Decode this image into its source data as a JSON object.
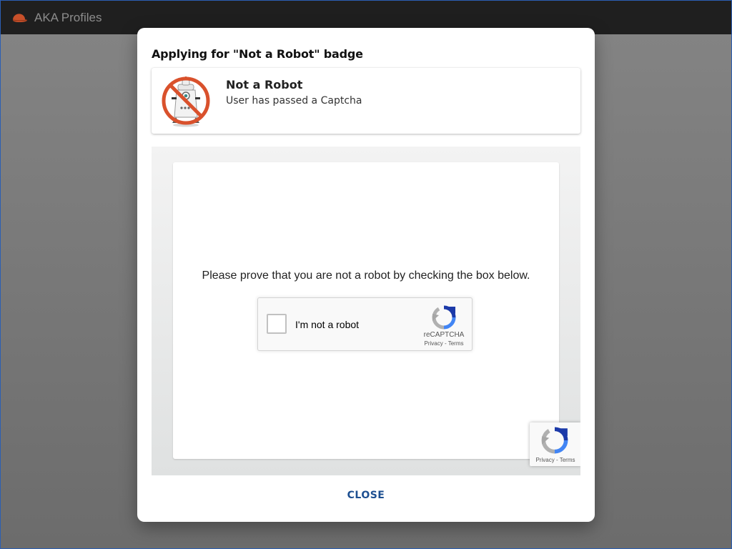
{
  "app": {
    "title": "AKA Profiles",
    "logo_icon": "cap-icon",
    "logo_color": "#c8502a"
  },
  "dialog": {
    "title": "Applying for \"Not a Robot\" badge",
    "badge": {
      "name": "Not a Robot",
      "description": "User has passed a Captcha",
      "image_icon": "no-robot-icon"
    },
    "captcha": {
      "prompt": "Please prove that you are not a robot by checking the box below.",
      "checkbox_label": "I'm not a robot",
      "checked": false,
      "brand": "reCAPTCHA",
      "links": "Privacy - Terms",
      "floating_links": "Privacy - Terms"
    },
    "close_label": "CLOSE"
  },
  "colors": {
    "accent": "#1d4f91",
    "topbar": "#1f1f1f",
    "badge_ring": "#d9512c"
  }
}
